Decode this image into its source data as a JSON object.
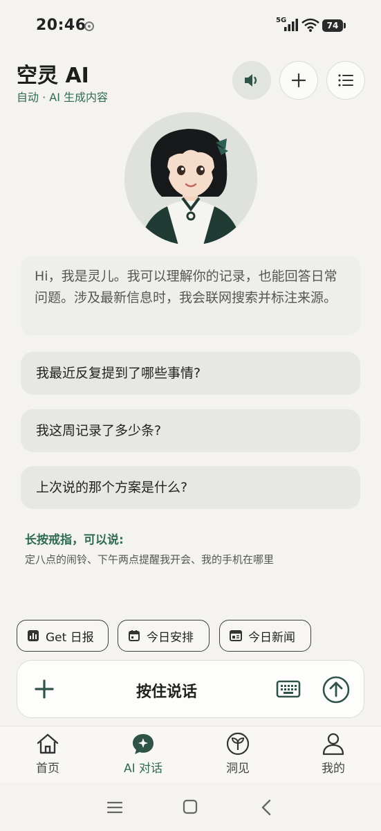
{
  "status_bar": {
    "time": "20:46",
    "network": "5G",
    "battery": "74"
  },
  "header": {
    "title": "空灵 AI",
    "subtitle": "自动 · AI 生成内容"
  },
  "greeting": "Hi，我是灵儿。我可以理解你的记录，也能回答日常问题。涉及最新信息时，我会联网搜索并标注来源。",
  "suggestions": [
    "我最近反复提到了哪些事情?",
    "我这周记录了多少条?",
    "上次说的那个方案是什么?"
  ],
  "tip": {
    "title": "长按戒指，可以说:",
    "text": "定八点的闹铃、下午两点提醒我开会、我的手机在哪里"
  },
  "quick_actions": [
    "Get 日报",
    "今日安排",
    "今日新闻"
  ],
  "input_bar": {
    "hold_to_talk": "按住说话"
  },
  "tabs": [
    {
      "label": "首页",
      "icon": "home-icon"
    },
    {
      "label": "AI 对话",
      "icon": "ai-chat-icon",
      "active": true
    },
    {
      "label": "洞见",
      "icon": "sprout-icon"
    },
    {
      "label": "我的",
      "icon": "user-icon"
    }
  ],
  "colors": {
    "accent": "#2f6b52",
    "background": "#f4f3ef"
  }
}
